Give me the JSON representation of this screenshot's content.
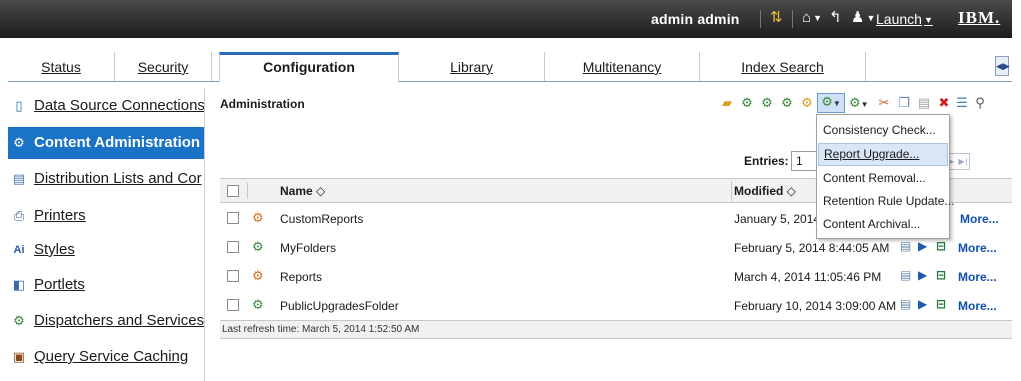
{
  "topbar": {
    "user": "admin admin",
    "launch": "Launch",
    "brand": "IBM.",
    "icons": [
      "refresh-icon",
      "home-icon",
      "back-icon",
      "user-icon"
    ]
  },
  "tabs": [
    {
      "label": "Status"
    },
    {
      "label": "Security"
    },
    {
      "label": "Configuration",
      "active": true
    },
    {
      "label": "Library"
    },
    {
      "label": "Multitenancy"
    },
    {
      "label": "Index Search"
    }
  ],
  "sidebar": {
    "items": [
      {
        "label": "Data Source Connections",
        "icon": "database-icon"
      },
      {
        "label": "Content Administration",
        "icon": "content-admin-icon",
        "selected": true
      },
      {
        "label": "Distribution Lists and Cor",
        "icon": "distribution-list-icon"
      },
      {
        "label": "Printers",
        "icon": "printer-icon"
      },
      {
        "label": "Styles",
        "icon": "styles-icon"
      },
      {
        "label": "Portlets",
        "icon": "portlet-icon"
      },
      {
        "label": "Dispatchers and Services",
        "icon": "dispatcher-icon"
      },
      {
        "label": "Query Service Caching",
        "icon": "query-cache-icon"
      }
    ]
  },
  "main": {
    "title": "Administration",
    "entries_label": "Entries:",
    "entries_value": "1",
    "columns": {
      "name": "Name ◇",
      "modified": "Modified ◇"
    },
    "rows": [
      {
        "name": "CustomReports",
        "modified": "January 5, 2014",
        "type": "folder-export",
        "more": "More..."
      },
      {
        "name": "MyFolders",
        "modified": "February 5, 2014 8:44:05 AM",
        "type": "folder-import",
        "more": "More..."
      },
      {
        "name": "Reports",
        "modified": "March 4, 2014 11:05:46 PM",
        "type": "folder-export",
        "more": "More..."
      },
      {
        "name": "PublicUpgradesFolder",
        "modified": "February 10, 2014 3:09:00 AM",
        "type": "folder-import",
        "more": "More..."
      }
    ],
    "footer": "Last refresh time: March 5, 2014 1:52:50 AM"
  },
  "menu": {
    "items": [
      {
        "label": "Consistency Check..."
      },
      {
        "label": "Report Upgrade...",
        "highlighted": true
      },
      {
        "label": "Content Removal..."
      },
      {
        "label": "Retention Rule Update..."
      },
      {
        "label": "Content Archival..."
      }
    ]
  },
  "colors": {
    "selected_nav": "#1a73c7",
    "active_tab_border": "#2a6ebb",
    "link": "#1150aa",
    "topbar": "#2b2b2b"
  }
}
